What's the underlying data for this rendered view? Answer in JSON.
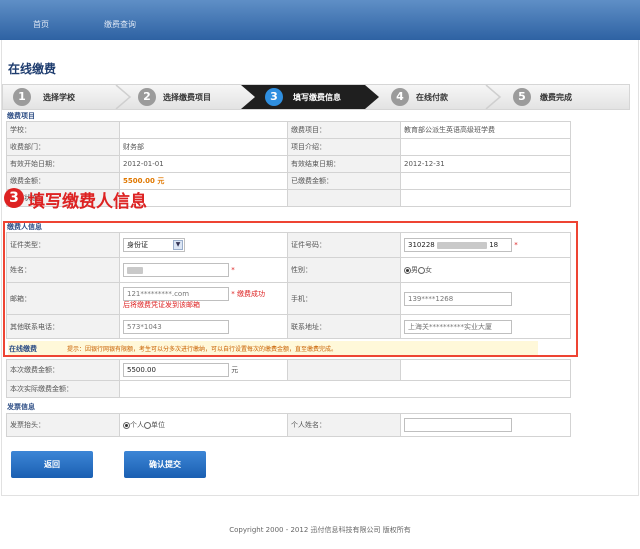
{
  "nav": {
    "home": "首页",
    "query": "缴费查询"
  },
  "page_title": "在线缴费",
  "steps": [
    {
      "num": "1",
      "label": "选择学校"
    },
    {
      "num": "2",
      "label": "选择缴费项目"
    },
    {
      "num": "3",
      "label": "填写缴费信息"
    },
    {
      "num": "4",
      "label": "在线付款"
    },
    {
      "num": "5",
      "label": "缴费完成"
    }
  ],
  "item_section": {
    "title": "缴费项目",
    "school_label": "学校：",
    "school_value": "",
    "item_label": "缴费项目：",
    "item_value": "教育部公派生英语高级班学费",
    "dept_label": "收费部门：",
    "dept_value": "财务部",
    "desc_label": "项目介绍：",
    "desc_value": "",
    "start_label": "有效开始日期：",
    "start_value": "2012-01-01",
    "end_label": "有效结束日期：",
    "end_value": "2012-12-31",
    "amount_label": "缴费金额：",
    "amount_value": "5500.00 元",
    "paid_label": "已缴费金额：",
    "paid_value": "",
    "status_label": "缴费状态：",
    "status_value": ""
  },
  "annotation": {
    "num": "3",
    "text": "填写缴费人信息"
  },
  "payer_section": {
    "title": "缴费人信息",
    "id_type_label": "证件类型：",
    "id_type_value": "身份证",
    "id_no_label": "证件号码：",
    "id_no_prefix": "310228",
    "id_no_suffix": "18",
    "name_label": "姓名：",
    "gender_label": "性别：",
    "gender_male": "男",
    "gender_female": "女",
    "email_label": "邮箱：",
    "email_value": "121*********.com",
    "email_success": "* 缴费成功",
    "email_note": "后将缴费凭证发到该邮箱",
    "phone_label": "手机：",
    "phone_value": "139****1268",
    "other_phone_label": "其他联系电话：",
    "other_phone_value": "573*1043",
    "address_label": "联系地址：",
    "address_value": "上海关**********实业大厦",
    "required_mark": "*"
  },
  "online_section": {
    "title": "在线缴费",
    "tip": "提示：因银行网银有限额，考生可以分多次进行缴纳，可以自行设置每次的缴费金额，直至缴费完成。",
    "this_amount_label": "本次缴费金额：",
    "this_amount_value": "5500.00",
    "unit": "元",
    "actual_label": "本次实际缴费金额：",
    "actual_value": ""
  },
  "invoice_section": {
    "title": "发票信息",
    "header_label": "发票抬头：",
    "opt_personal": "个人",
    "opt_company": "单位",
    "person_label": "个人姓名：",
    "person_value": ""
  },
  "buttons": {
    "back": "返回",
    "submit": "确认提交"
  },
  "footer": "Copyright 2000 - 2012 迅付信息科技有限公司 版权所有"
}
